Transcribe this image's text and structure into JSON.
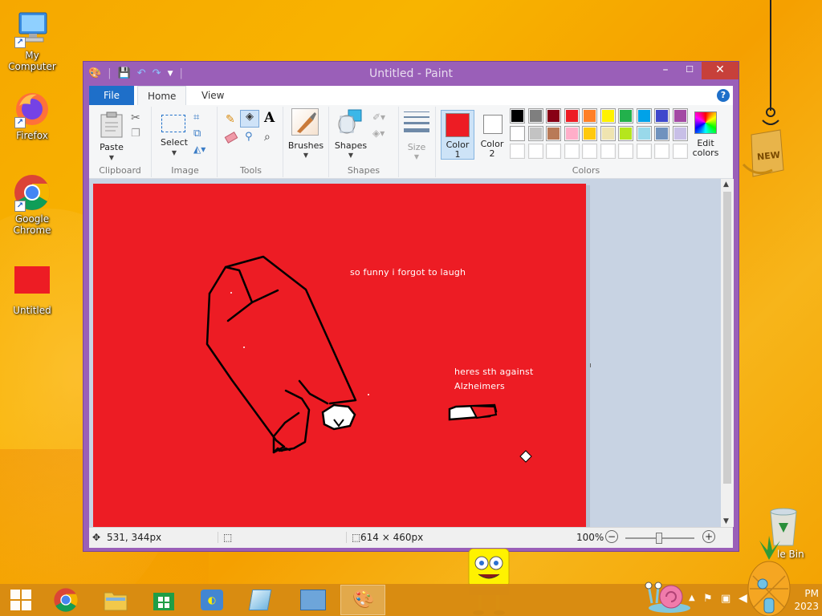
{
  "desktop": {
    "icons": [
      {
        "label": "My Computer"
      },
      {
        "label": "Firefox"
      },
      {
        "label": "Google Chrome"
      },
      {
        "label": "Untitled"
      }
    ],
    "recycle_bin_label": "le Bin",
    "new_badge": "NEW"
  },
  "window": {
    "title": "Untitled - Paint",
    "controls": {
      "minimize": "–",
      "maximize": "☐",
      "close": "✕"
    }
  },
  "ribbon": {
    "tabs": {
      "file": "File",
      "home": "Home",
      "view": "View"
    },
    "help": "?",
    "clipboard": {
      "paste": "Paste",
      "group": "Clipboard"
    },
    "image": {
      "select": "Select",
      "group": "Image"
    },
    "tools": {
      "text_tool": "A",
      "group": "Tools"
    },
    "brushes": {
      "label": "Brushes"
    },
    "shapes": {
      "label": "Shapes",
      "group": "Shapes"
    },
    "size": {
      "label": "Size"
    },
    "colors": {
      "color1": "Color",
      "color1_num": "1",
      "color2": "Color",
      "color2_num": "2",
      "edit1": "Edit",
      "edit2": "colors",
      "group": "Colors",
      "color1_value": "#ed1c24",
      "color2_value": "#ffffff",
      "palette_row1": [
        "#000000",
        "#7f7f7f",
        "#880015",
        "#ed1c24",
        "#ff7f27",
        "#fff200",
        "#22b14c",
        "#00a2e8",
        "#3f48cc",
        "#a349a4"
      ],
      "palette_row2": [
        "#ffffff",
        "#c3c3c3",
        "#b97a57",
        "#ffaec9",
        "#ffc90e",
        "#efe4b0",
        "#b5e61d",
        "#99d9ea",
        "#7092be",
        "#c8bfe7"
      ],
      "palette_row3": [
        "#ffffff",
        "#ffffff",
        "#ffffff",
        "#ffffff",
        "#ffffff",
        "#ffffff",
        "#ffffff",
        "#ffffff",
        "#ffffff",
        "#ffffff"
      ]
    }
  },
  "canvas": {
    "background": "#ed1c24",
    "text1": "so funny i forgot to laugh",
    "text2_line1": "heres sth against",
    "text2_line2": "Alzheimers"
  },
  "status": {
    "cursor_pos": "531, 344px",
    "image_size": "614 × 460px",
    "zoom": "100%"
  },
  "taskbar": {
    "clock_time": "PM",
    "clock_date": "2023"
  }
}
